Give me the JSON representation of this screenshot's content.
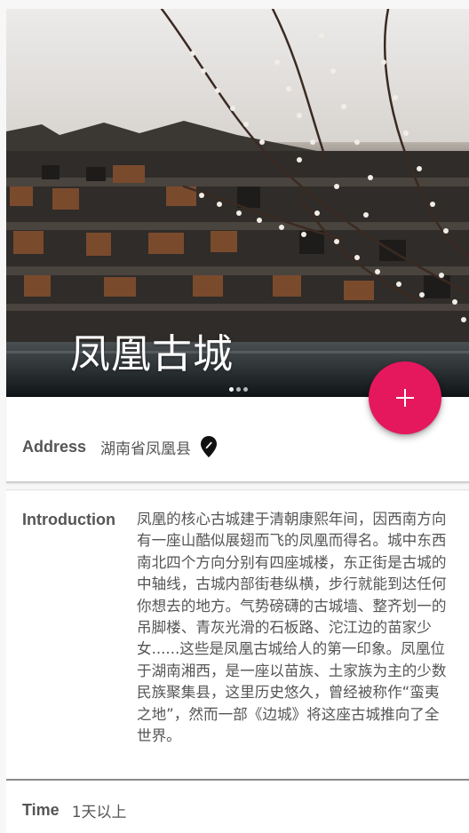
{
  "hero": {
    "title": "凤凰古城",
    "carousel": {
      "count": 3,
      "active_index": 0
    }
  },
  "fab": {
    "icon": "plus-icon",
    "color": "#e5175d"
  },
  "address": {
    "label": "Address",
    "value": "湖南省凤凰县",
    "icon": "map-pin-icon"
  },
  "introduction": {
    "label": "Introduction",
    "text": "凤凰的核心古城建于清朝康熙年间，因西南方向有一座山酷似展翅而飞的凤凰而得名。城中东西南北四个方向分别有四座城楼，东正街是古城的中轴线，古城内部街巷纵横，步行就能到达任何你想去的地方。气势磅礴的古城墙、整齐划一的吊脚楼、青灰光滑的石板路、沱江边的苗家少女......这些是凤凰古城给人的第一印象。凤凰位于湖南湘西，是一座以苗族、土家族为主的少数民族聚集县，这里历史悠久，曾经被称作“蛮夷之地”，然而一部《边城》将这座古城推向了全世界。"
  },
  "time": {
    "label": "Time",
    "value": "1天以上"
  }
}
